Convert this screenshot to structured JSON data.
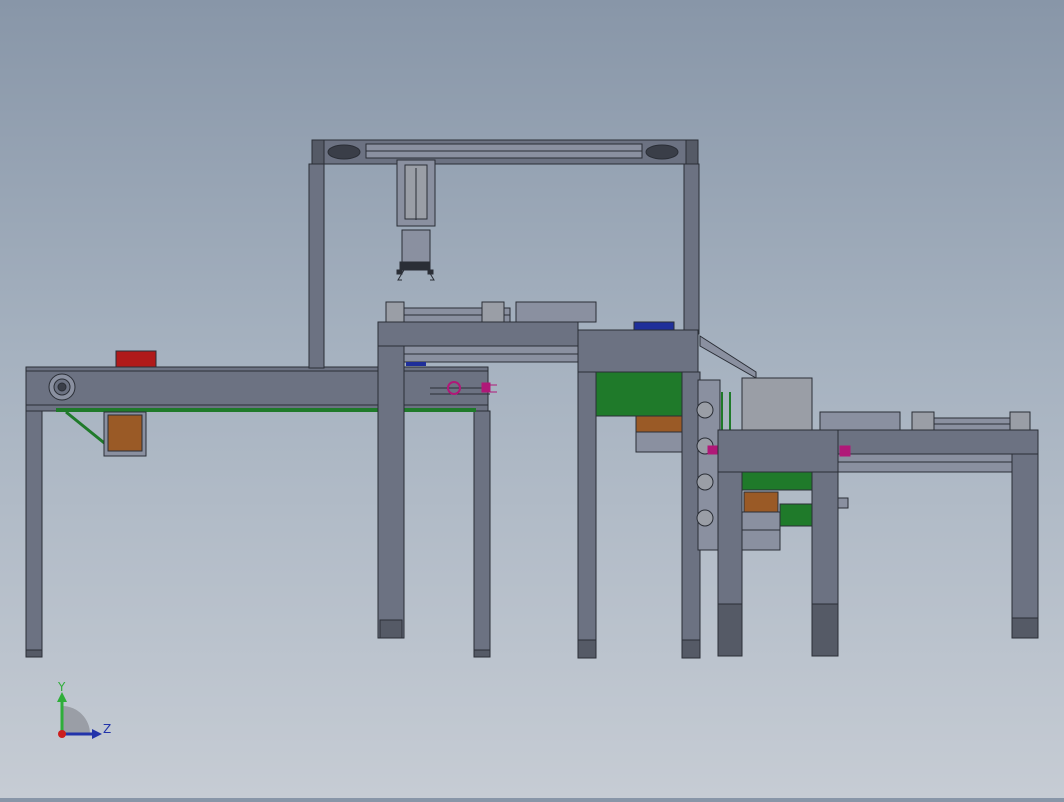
{
  "triad": {
    "y_label": "Y",
    "z_label": "Z",
    "colors": {
      "y": "#2fae3a",
      "z": "#2233aa",
      "x": "#cc1e1e"
    }
  },
  "colors": {
    "frame": "#6c7282",
    "frame_light": "#8a90a0",
    "outline": "#2a2e36",
    "green": "#1f7a2a",
    "brown": "#9a5a26",
    "red": "#b01a1a",
    "blue": "#1f2f9a",
    "grey_box": "#9a9ea6",
    "magenta": "#b01878"
  }
}
